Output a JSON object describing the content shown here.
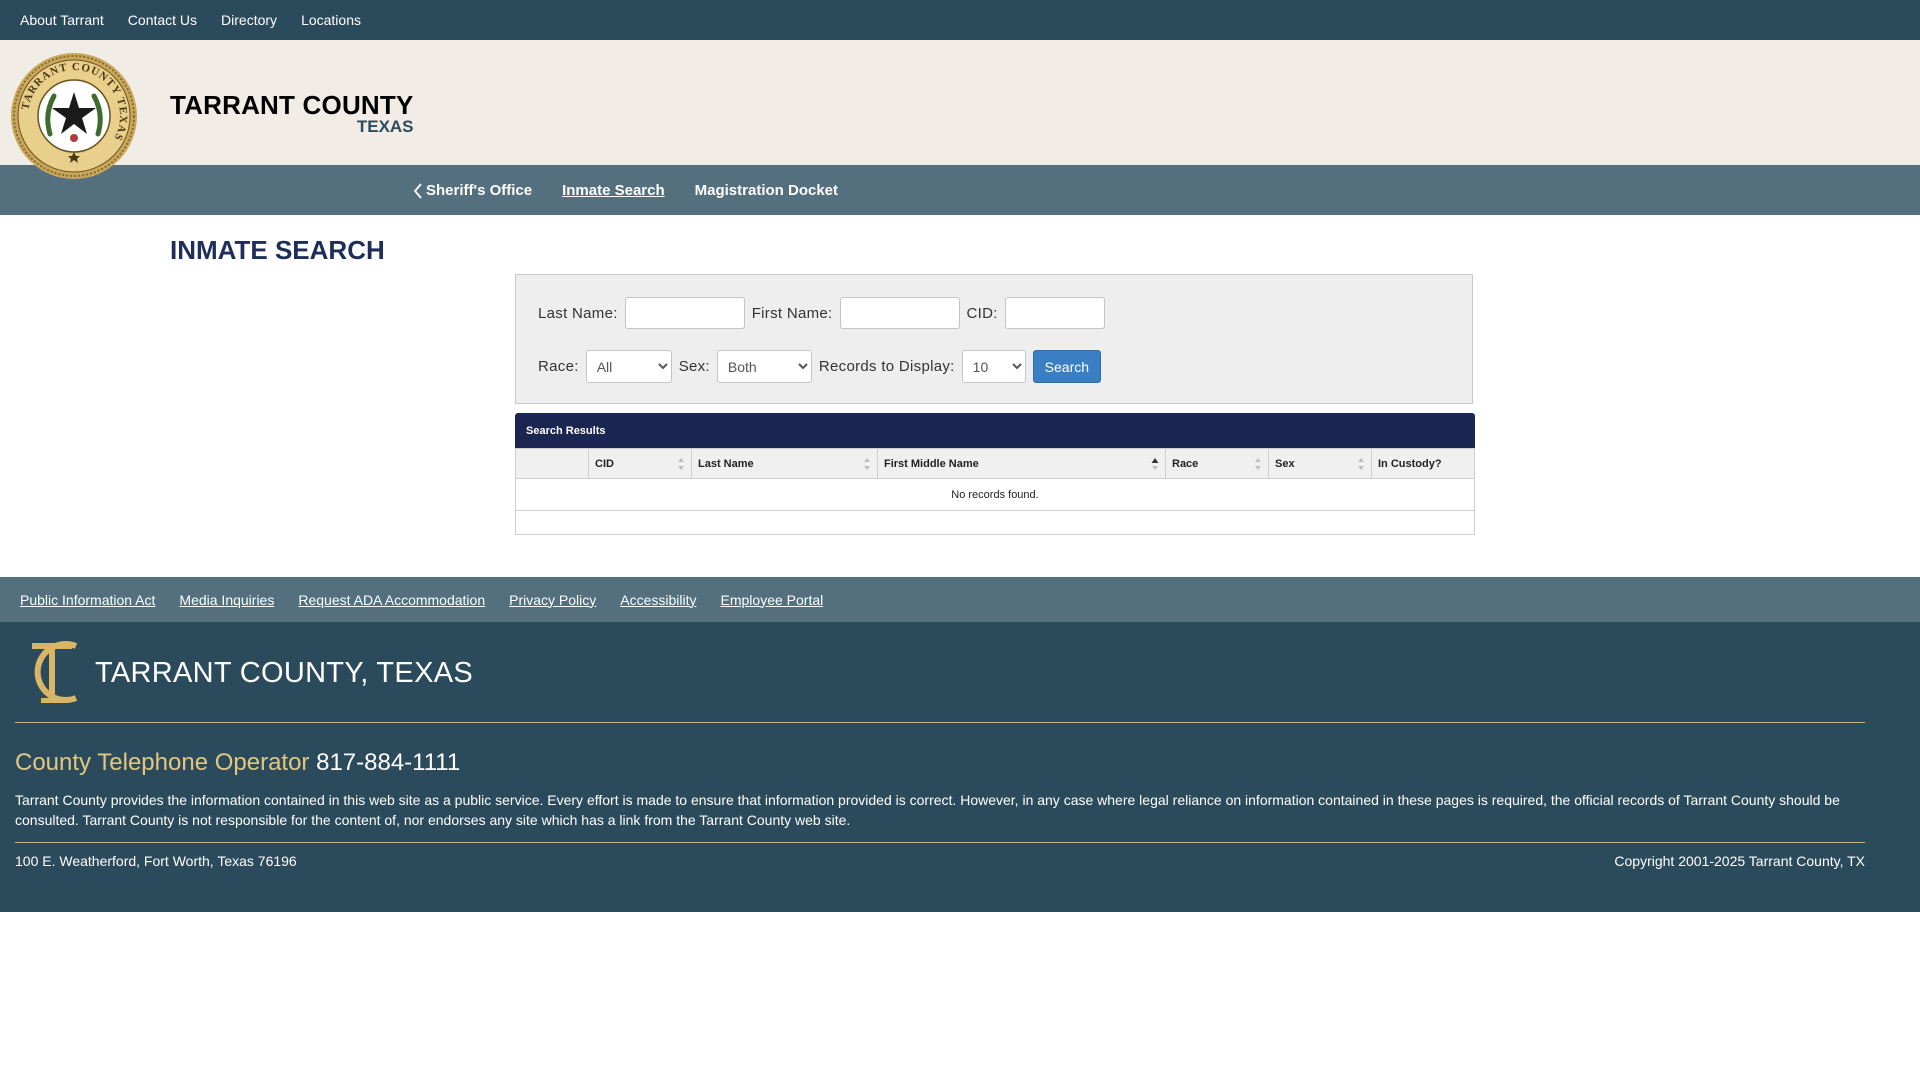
{
  "topbar": {
    "items": [
      "About Tarrant",
      "Contact Us",
      "Directory",
      "Locations"
    ]
  },
  "header": {
    "county": "TARRANT COUNTY",
    "state": "TEXAS",
    "seal_text": "TARRANT COUNTY TEXAS"
  },
  "subnav": {
    "items": [
      "Sheriff's Office",
      "Inmate Search",
      "Magistration Docket"
    ],
    "active": "Inmate Search"
  },
  "page_title": "INMATE SEARCH",
  "form": {
    "last_name_label": "Last Name:",
    "first_name_label": "First Name:",
    "cid_label": "CID:",
    "last_name_value": "",
    "first_name_value": "",
    "cid_value": "",
    "race_label": "Race:",
    "race_value": "All",
    "sex_label": "Sex:",
    "sex_value": "Both",
    "records_label": "Records to Display:",
    "records_value": "10",
    "search_button": "Search"
  },
  "results": {
    "title": "Search Results",
    "columns": [
      "",
      "CID",
      "Last Name",
      "First Middle Name",
      "Race",
      "Sex",
      "In Custody?"
    ],
    "sorted_column": "First Middle Name",
    "empty_message": "No records found."
  },
  "footer_links": [
    "Public Information Act",
    "Media Inquiries",
    "Request ADA Accommodation",
    "Privacy Policy",
    "Accessibility",
    "Employee Portal"
  ],
  "footer": {
    "county": "TARRANT COUNTY, TEXAS",
    "phone_label": "County Telephone Operator",
    "phone_number": "817-884-1111",
    "disclaimer": "Tarrant County provides the information contained in this web site as a public service. Every effort is made to ensure that information provided is correct. However, in any case where legal reliance on information contained in these pages is required, the official records of Tarrant County should be consulted. Tarrant County is not responsible for the content of, nor endorses any site which has a link from the Tarrant County web site.",
    "address": "100 E. Weatherford, Fort Worth, Texas 76196",
    "copyright": "Copyright 2001-2025 Tarrant County, TX"
  },
  "colors": {
    "primary_dark": "#2b4b5c",
    "nav": "#546f7e",
    "header_bg": "#f1ede6",
    "title_navy": "#1f2d5a",
    "accent_gold": "#e1c781",
    "button_blue": "#3a7fc4"
  }
}
